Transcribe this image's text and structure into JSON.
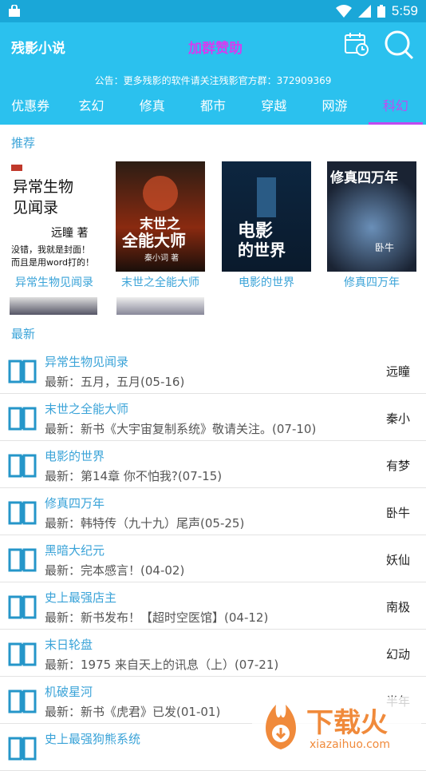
{
  "status": {
    "time": "5:59"
  },
  "app": {
    "title": "残影小说",
    "donate": "加群赞助",
    "notice": "公告：更多残影的软件请关注残影官方群：372909369"
  },
  "tabs": [
    "优惠券",
    "玄幻",
    "修真",
    "都市",
    "穿越",
    "网游",
    "科幻"
  ],
  "active_tab": 6,
  "recommend": {
    "label": "推荐",
    "books": [
      {
        "title": "异常生物见闻录",
        "cover_text": [
          "异常生物",
          "见闻录",
          "远瞳 著",
          "没错，我就是封面！",
          "而且是用word打的！"
        ]
      },
      {
        "title": "末世之全能大师",
        "cover_text": [
          "末世之",
          "全能大师",
          "秦小词 著"
        ]
      },
      {
        "title": "电影的世界",
        "cover_text": [
          "电影",
          "的世界"
        ]
      },
      {
        "title": "修真四万年",
        "cover_text": [
          "修真四万年",
          "卧牛"
        ]
      }
    ]
  },
  "latest": {
    "label": "最新",
    "items": [
      {
        "name": "异常生物见闻录",
        "latest": "最新：五月，五月(05-16)",
        "author": "远瞳"
      },
      {
        "name": "末世之全能大师",
        "latest": "最新：新书《大宇宙复制系统》敬请关注。(07-10)",
        "author": "秦小"
      },
      {
        "name": "电影的世界",
        "latest": "最新：第14章 你不怕我?(07-15)",
        "author": "有梦"
      },
      {
        "name": "修真四万年",
        "latest": "最新：韩特传（九十九）尾声(05-25)",
        "author": "卧牛"
      },
      {
        "name": "黑暗大纪元",
        "latest": "最新：完本感言！(04-02)",
        "author": "妖仙"
      },
      {
        "name": "史上最强店主",
        "latest": "最新：新书发布！【超时空医馆】(04-12)",
        "author": "南极"
      },
      {
        "name": "末日轮盘",
        "latest": "最新：1975 来自天上的讯息（上）(07-21)",
        "author": "幻动"
      },
      {
        "name": "机破星河",
        "latest": "最新：新书《虎君》已发(01-01)",
        "author": "半年"
      },
      {
        "name": "史上最强狗熊系统",
        "latest": "",
        "author": ""
      }
    ]
  },
  "watermark": {
    "text": "下载火",
    "url": "xiazaihuo.com"
  }
}
